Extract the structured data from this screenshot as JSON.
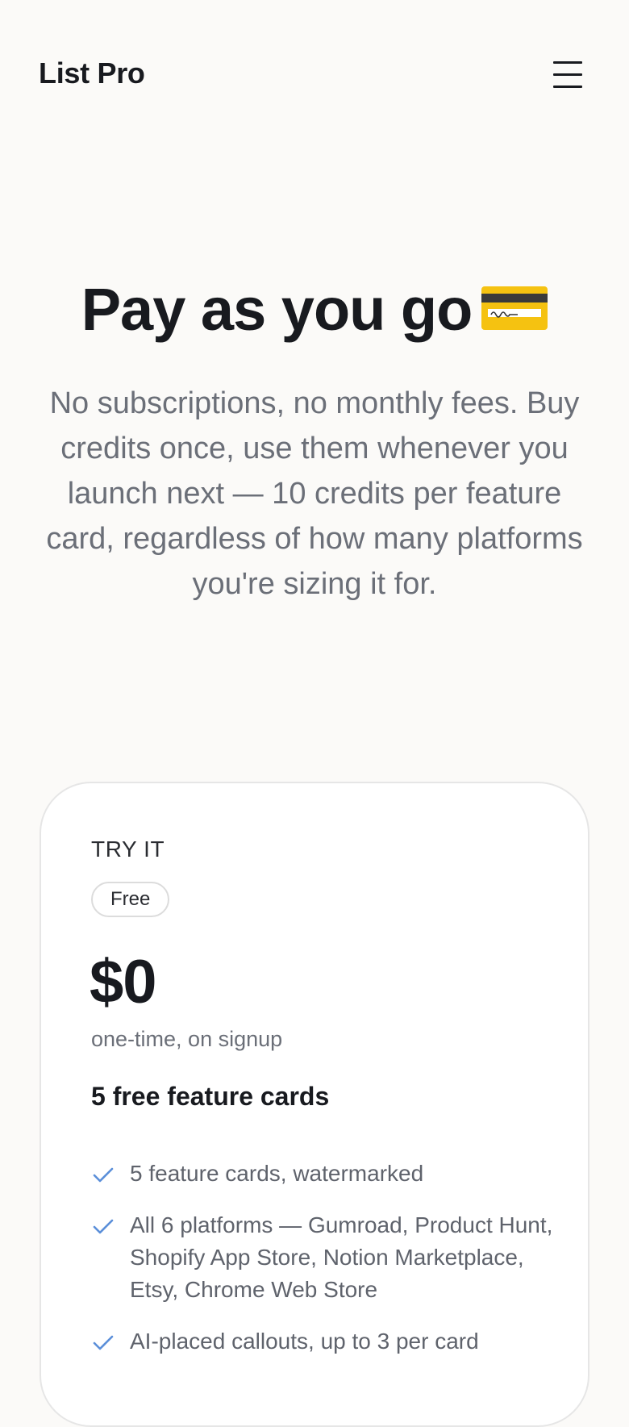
{
  "header": {
    "brand": "List Pro",
    "menu_icon": "hamburger-menu-icon"
  },
  "hero": {
    "title": "Pay as you go",
    "title_emoji": "credit-card-icon",
    "subtitle": "No subscriptions, no monthly fees. Buy credits once, use them whenever you launch next — 10 credits per feature card, regardless of how many platforms you're sizing it for."
  },
  "plan": {
    "tier_name": "TRY IT",
    "badge": "Free",
    "price": "$0",
    "price_note": "one-time, on signup",
    "credits": "5 free feature cards",
    "check_icon": "check-icon",
    "check_color": "#5b8fd9",
    "features": [
      "5 feature cards, watermarked",
      "All 6 platforms — Gumroad, Product Hunt, Shopify App Store, Notion Marketplace, Etsy, Chrome Web Store",
      "AI-placed callouts, up to 3 per card"
    ]
  },
  "colors": {
    "background": "#fbfaf8",
    "text_primary": "#181a1f",
    "text_muted": "#6b6f78",
    "card_border": "#e6e6e6",
    "card_icon_yellow": "#f5c211"
  }
}
